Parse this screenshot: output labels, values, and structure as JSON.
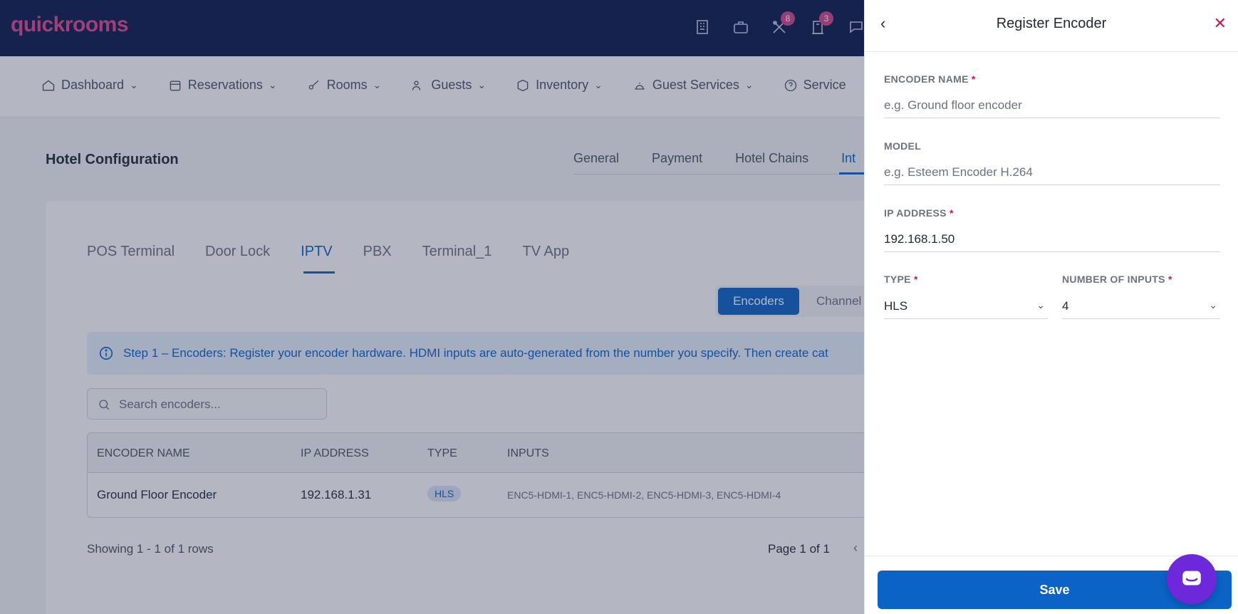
{
  "app": {
    "logo": "quickrooms"
  },
  "topbar": {
    "icons": [
      {
        "name": "building-icon",
        "badge": ""
      },
      {
        "name": "briefcase-icon",
        "badge": ""
      },
      {
        "name": "tools-icon",
        "badge": "8"
      },
      {
        "name": "hotel-icon",
        "badge": "3"
      },
      {
        "name": "chat-icon",
        "badge": ""
      }
    ]
  },
  "nav": {
    "items": [
      {
        "label": "Dashboard"
      },
      {
        "label": "Reservations"
      },
      {
        "label": "Rooms"
      },
      {
        "label": "Guests"
      },
      {
        "label": "Inventory"
      },
      {
        "label": "Guest Services"
      },
      {
        "label": "Service"
      }
    ]
  },
  "page": {
    "title": "Hotel Configuration",
    "tabs": [
      "General",
      "Payment",
      "Hotel Chains",
      "Int"
    ],
    "active_tab": "Int"
  },
  "subtabs": {
    "items": [
      "POS Terminal",
      "Door Lock",
      "IPTV",
      "PBX",
      "Terminal_1",
      "TV App"
    ],
    "active": "IPTV"
  },
  "segment": {
    "encoders": "Encoders",
    "channels": "Channel"
  },
  "info": {
    "text": "Step 1 – Encoders: Register your encoder hardware. HDMI inputs are auto-generated from the number you specify. Then create cat"
  },
  "search": {
    "placeholder": "Search encoders..."
  },
  "table": {
    "headers": [
      "ENCODER NAME",
      "IP ADDRESS",
      "TYPE",
      "INPUTS"
    ],
    "rows": [
      {
        "name": "Ground Floor Encoder",
        "ip": "192.168.1.31",
        "type": "HLS",
        "inputs": "ENC5-HDMI-1, ENC5-HDMI-2, ENC5-HDMI-3, ENC5-HDMI-4"
      }
    ]
  },
  "pagination": {
    "showing": "Showing 1 - 1 of 1 rows",
    "page": "Page 1 of 1",
    "prev": "‹"
  },
  "panel": {
    "title": "Register Encoder",
    "back": "‹",
    "close": "✕",
    "encoder_name": {
      "label": "ENCODER NAME",
      "required": "*",
      "placeholder": "e.g. Ground floor encoder",
      "value": ""
    },
    "model": {
      "label": "MODEL",
      "placeholder": "e.g. Esteem Encoder H.264",
      "value": ""
    },
    "ip_address": {
      "label": "IP ADDRESS",
      "required": "*",
      "placeholder": "",
      "value": "192.168.1.50"
    },
    "type": {
      "label": "TYPE",
      "required": "*",
      "value": "HLS"
    },
    "number_of_inputs": {
      "label": "NUMBER OF INPUTS",
      "required": "*",
      "value": "4"
    },
    "save": "Save"
  },
  "colors": {
    "brand": "#0b63c5",
    "topbar": "#0c1b4d",
    "logo": "#e2478f",
    "chat": "#6d28d9"
  }
}
